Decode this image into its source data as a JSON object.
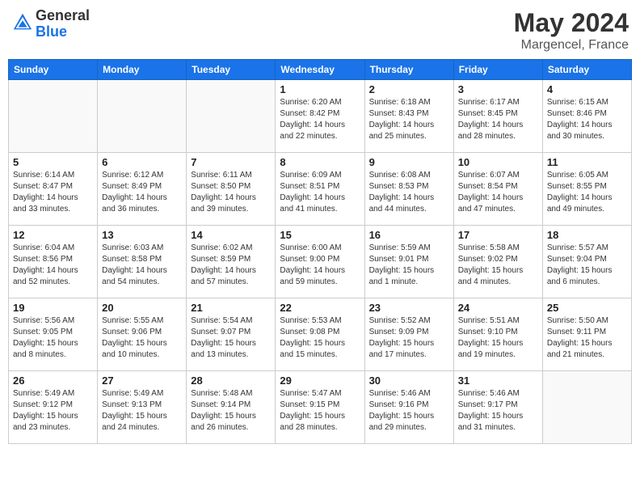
{
  "header": {
    "logo_general": "General",
    "logo_blue": "Blue",
    "month_title": "May 2024",
    "location": "Margencel, France"
  },
  "days_of_week": [
    "Sunday",
    "Monday",
    "Tuesday",
    "Wednesday",
    "Thursday",
    "Friday",
    "Saturday"
  ],
  "weeks": [
    [
      {
        "day": "",
        "info": ""
      },
      {
        "day": "",
        "info": ""
      },
      {
        "day": "",
        "info": ""
      },
      {
        "day": "1",
        "info": "Sunrise: 6:20 AM\nSunset: 8:42 PM\nDaylight: 14 hours\nand 22 minutes."
      },
      {
        "day": "2",
        "info": "Sunrise: 6:18 AM\nSunset: 8:43 PM\nDaylight: 14 hours\nand 25 minutes."
      },
      {
        "day": "3",
        "info": "Sunrise: 6:17 AM\nSunset: 8:45 PM\nDaylight: 14 hours\nand 28 minutes."
      },
      {
        "day": "4",
        "info": "Sunrise: 6:15 AM\nSunset: 8:46 PM\nDaylight: 14 hours\nand 30 minutes."
      }
    ],
    [
      {
        "day": "5",
        "info": "Sunrise: 6:14 AM\nSunset: 8:47 PM\nDaylight: 14 hours\nand 33 minutes."
      },
      {
        "day": "6",
        "info": "Sunrise: 6:12 AM\nSunset: 8:49 PM\nDaylight: 14 hours\nand 36 minutes."
      },
      {
        "day": "7",
        "info": "Sunrise: 6:11 AM\nSunset: 8:50 PM\nDaylight: 14 hours\nand 39 minutes."
      },
      {
        "day": "8",
        "info": "Sunrise: 6:09 AM\nSunset: 8:51 PM\nDaylight: 14 hours\nand 41 minutes."
      },
      {
        "day": "9",
        "info": "Sunrise: 6:08 AM\nSunset: 8:53 PM\nDaylight: 14 hours\nand 44 minutes."
      },
      {
        "day": "10",
        "info": "Sunrise: 6:07 AM\nSunset: 8:54 PM\nDaylight: 14 hours\nand 47 minutes."
      },
      {
        "day": "11",
        "info": "Sunrise: 6:05 AM\nSunset: 8:55 PM\nDaylight: 14 hours\nand 49 minutes."
      }
    ],
    [
      {
        "day": "12",
        "info": "Sunrise: 6:04 AM\nSunset: 8:56 PM\nDaylight: 14 hours\nand 52 minutes."
      },
      {
        "day": "13",
        "info": "Sunrise: 6:03 AM\nSunset: 8:58 PM\nDaylight: 14 hours\nand 54 minutes."
      },
      {
        "day": "14",
        "info": "Sunrise: 6:02 AM\nSunset: 8:59 PM\nDaylight: 14 hours\nand 57 minutes."
      },
      {
        "day": "15",
        "info": "Sunrise: 6:00 AM\nSunset: 9:00 PM\nDaylight: 14 hours\nand 59 minutes."
      },
      {
        "day": "16",
        "info": "Sunrise: 5:59 AM\nSunset: 9:01 PM\nDaylight: 15 hours\nand 1 minute."
      },
      {
        "day": "17",
        "info": "Sunrise: 5:58 AM\nSunset: 9:02 PM\nDaylight: 15 hours\nand 4 minutes."
      },
      {
        "day": "18",
        "info": "Sunrise: 5:57 AM\nSunset: 9:04 PM\nDaylight: 15 hours\nand 6 minutes."
      }
    ],
    [
      {
        "day": "19",
        "info": "Sunrise: 5:56 AM\nSunset: 9:05 PM\nDaylight: 15 hours\nand 8 minutes."
      },
      {
        "day": "20",
        "info": "Sunrise: 5:55 AM\nSunset: 9:06 PM\nDaylight: 15 hours\nand 10 minutes."
      },
      {
        "day": "21",
        "info": "Sunrise: 5:54 AM\nSunset: 9:07 PM\nDaylight: 15 hours\nand 13 minutes."
      },
      {
        "day": "22",
        "info": "Sunrise: 5:53 AM\nSunset: 9:08 PM\nDaylight: 15 hours\nand 15 minutes."
      },
      {
        "day": "23",
        "info": "Sunrise: 5:52 AM\nSunset: 9:09 PM\nDaylight: 15 hours\nand 17 minutes."
      },
      {
        "day": "24",
        "info": "Sunrise: 5:51 AM\nSunset: 9:10 PM\nDaylight: 15 hours\nand 19 minutes."
      },
      {
        "day": "25",
        "info": "Sunrise: 5:50 AM\nSunset: 9:11 PM\nDaylight: 15 hours\nand 21 minutes."
      }
    ],
    [
      {
        "day": "26",
        "info": "Sunrise: 5:49 AM\nSunset: 9:12 PM\nDaylight: 15 hours\nand 23 minutes."
      },
      {
        "day": "27",
        "info": "Sunrise: 5:49 AM\nSunset: 9:13 PM\nDaylight: 15 hours\nand 24 minutes."
      },
      {
        "day": "28",
        "info": "Sunrise: 5:48 AM\nSunset: 9:14 PM\nDaylight: 15 hours\nand 26 minutes."
      },
      {
        "day": "29",
        "info": "Sunrise: 5:47 AM\nSunset: 9:15 PM\nDaylight: 15 hours\nand 28 minutes."
      },
      {
        "day": "30",
        "info": "Sunrise: 5:46 AM\nSunset: 9:16 PM\nDaylight: 15 hours\nand 29 minutes."
      },
      {
        "day": "31",
        "info": "Sunrise: 5:46 AM\nSunset: 9:17 PM\nDaylight: 15 hours\nand 31 minutes."
      },
      {
        "day": "",
        "info": ""
      }
    ]
  ]
}
